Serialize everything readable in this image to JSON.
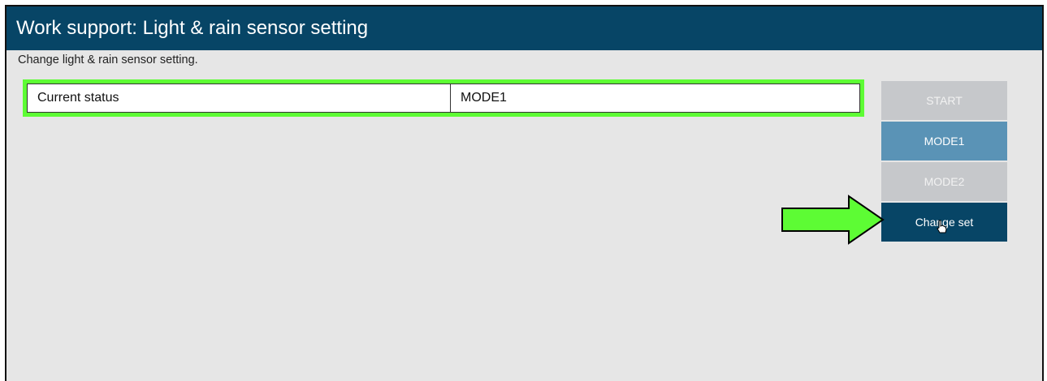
{
  "header": {
    "title": "Work support: Light & rain sensor setting"
  },
  "subtitle": "Change light & rain sensor setting.",
  "status": {
    "label": "Current status",
    "value": "MODE1"
  },
  "buttons": {
    "start": "START",
    "mode1": "MODE1",
    "mode2": "MODE2",
    "change_set": "Change set"
  },
  "colors": {
    "header_bg": "#074566",
    "highlight": "#5dfc34",
    "active_mode": "#5a93b6",
    "disabled": "#c6c8cb",
    "primary": "#074566"
  },
  "annotations": {
    "arrow": "green-arrow-icon",
    "cursor": "hand-pointer-icon"
  }
}
